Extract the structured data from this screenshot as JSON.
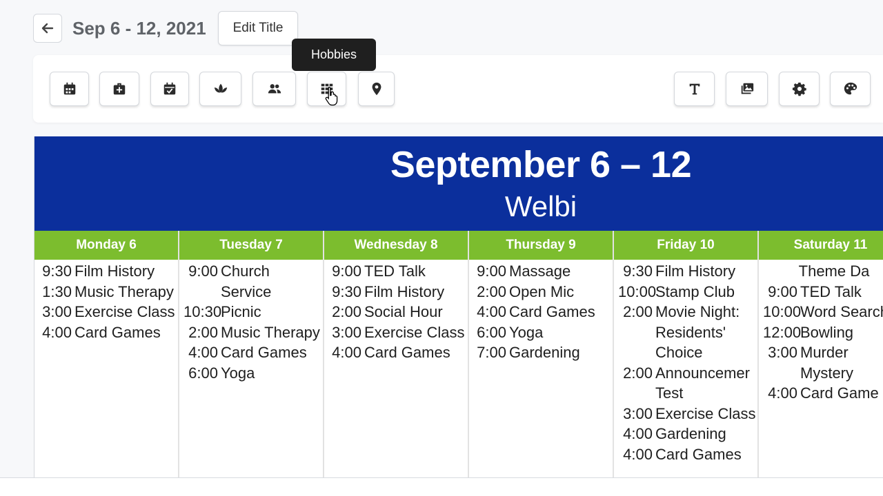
{
  "header": {
    "title": "Sep 6 - 12, 2021",
    "edit_title_label": "Edit Title"
  },
  "toolbar": {
    "tooltip": "Hobbies",
    "left_tools": [
      {
        "name": "calendar-tool",
        "icon": "calendar-icon"
      },
      {
        "name": "health-tool",
        "icon": "medical-kit-icon"
      },
      {
        "name": "events-tool",
        "icon": "calendar-check-icon"
      },
      {
        "name": "wellness-tool",
        "icon": "lotus-icon"
      },
      {
        "name": "people-tool",
        "icon": "users-icon"
      },
      {
        "name": "hobbies-tool",
        "icon": "grid-icon"
      },
      {
        "name": "location-tool",
        "icon": "map-pin-icon"
      }
    ],
    "right_tools": [
      {
        "name": "text-tool",
        "icon": "text-icon"
      },
      {
        "name": "images-tool",
        "icon": "images-icon"
      },
      {
        "name": "settings-tool",
        "icon": "gear-icon"
      },
      {
        "name": "theme-tool",
        "icon": "palette-icon"
      }
    ]
  },
  "calendar": {
    "title": "September 6 – 12",
    "subtitle": "Welbi",
    "header_color": "#0b2f9c",
    "day_color": "#7cbd2e",
    "days": [
      {
        "label": "Monday 6",
        "events": [
          {
            "time": "9:30",
            "name": "Film History"
          },
          {
            "time": "1:30",
            "name": "Music Therapy"
          },
          {
            "time": "3:00",
            "name": "Exercise Class"
          },
          {
            "time": "4:00",
            "name": "Card Games"
          }
        ]
      },
      {
        "label": "Tuesday 7",
        "events": [
          {
            "time": "9:00",
            "name": "Church Service"
          },
          {
            "time": "10:30",
            "name": "Picnic"
          },
          {
            "time": "2:00",
            "name": "Music Therapy"
          },
          {
            "time": "4:00",
            "name": "Card Games"
          },
          {
            "time": "6:00",
            "name": "Yoga"
          }
        ]
      },
      {
        "label": "Wednesday 8",
        "events": [
          {
            "time": "9:00",
            "name": "TED Talk"
          },
          {
            "time": "9:30",
            "name": "Film History"
          },
          {
            "time": "2:00",
            "name": "Social Hour"
          },
          {
            "time": "3:00",
            "name": "Exercise Class"
          },
          {
            "time": "4:00",
            "name": "Card Games"
          }
        ]
      },
      {
        "label": "Thursday 9",
        "events": [
          {
            "time": "9:00",
            "name": "Massage"
          },
          {
            "time": "2:00",
            "name": "Open Mic"
          },
          {
            "time": "4:00",
            "name": "Card Games"
          },
          {
            "time": "6:00",
            "name": "Yoga"
          },
          {
            "time": "7:00",
            "name": "Gardening"
          }
        ]
      },
      {
        "label": "Friday 10",
        "events": [
          {
            "time": "9:30",
            "name": "Film History"
          },
          {
            "time": "10:00",
            "name": "Stamp Club"
          },
          {
            "time": "2:00",
            "name": "Movie Night: Residents' Choice"
          },
          {
            "time": "2:00",
            "name": "Announcemer Test"
          },
          {
            "time": "3:00",
            "name": "Exercise Class"
          },
          {
            "time": "4:00",
            "name": "Gardening"
          },
          {
            "time": "4:00",
            "name": "Card Games"
          }
        ]
      },
      {
        "label": "Saturday 11",
        "events": [
          {
            "time": "",
            "name": "Theme Da"
          },
          {
            "time": "9:00",
            "name": "TED Talk"
          },
          {
            "time": "10:00",
            "name": "Word Search"
          },
          {
            "time": "12:00",
            "name": "Bowling"
          },
          {
            "time": "3:00",
            "name": "Murder Mystery"
          },
          {
            "time": "4:00",
            "name": "Card Game"
          }
        ]
      }
    ]
  }
}
